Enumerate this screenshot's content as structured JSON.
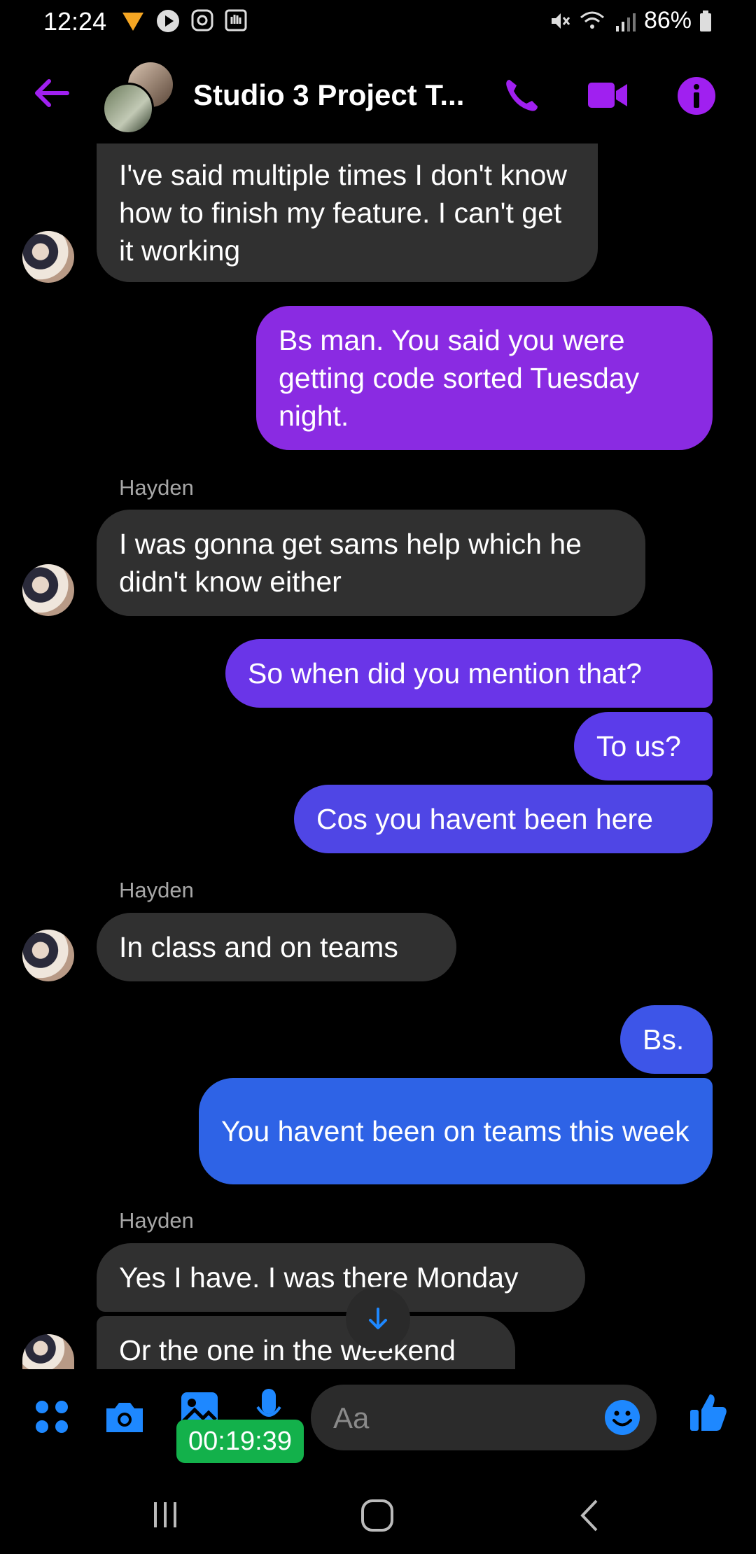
{
  "status": {
    "time": "12:24",
    "battery": "86%"
  },
  "header": {
    "title": "Studio 3 Project T...",
    "accent": "#a020f0"
  },
  "messages": [
    {
      "kind": "recv",
      "text": "I've said multiple times I don't know how to finish my feature. I can't get it working"
    },
    {
      "kind": "sent",
      "text": "Bs man. You said you were getting code sorted Tuesday night."
    },
    {
      "kind": "sender",
      "text": "Hayden"
    },
    {
      "kind": "recv",
      "text": "I was gonna get sams help which he didn't know either"
    },
    {
      "kind": "sent",
      "text": "So when did you mention that?"
    },
    {
      "kind": "sent",
      "text": "To us?"
    },
    {
      "kind": "sent",
      "text": "Cos you havent been here"
    },
    {
      "kind": "sender",
      "text": "Hayden"
    },
    {
      "kind": "recv",
      "text": "In class and on teams"
    },
    {
      "kind": "sent",
      "text": "Bs."
    },
    {
      "kind": "sent",
      "text": "You havent been on teams this week"
    },
    {
      "kind": "sender",
      "text": "Hayden"
    },
    {
      "kind": "recv",
      "text": "Yes I have. I was there Monday"
    },
    {
      "kind": "recv",
      "text": "Or the one in the weekend"
    }
  ],
  "composer": {
    "placeholder": "Aa",
    "timer": "00:19:39"
  },
  "icons": {
    "back": "back-arrow-icon",
    "call": "phone-icon",
    "video": "video-camera-icon",
    "info": "info-icon",
    "menu": "four-dots-icon",
    "camera": "camera-icon",
    "gallery": "image-icon",
    "mic": "microphone-icon",
    "emoji": "smiley-icon",
    "like": "thumbs-up-icon",
    "scroll": "arrow-down-icon"
  }
}
